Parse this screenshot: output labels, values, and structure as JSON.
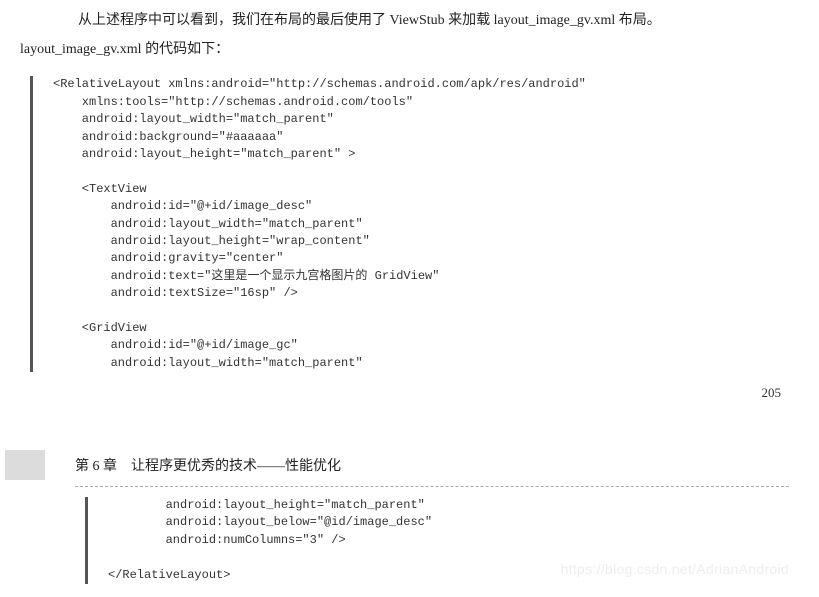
{
  "intro_para1": "从上述程序中可以看到，我们在布局的最后使用了 ViewStub 来加载 layout_image_gv.xml 布局。",
  "intro_para2": "layout_image_gv.xml 的代码如下：",
  "code_block1": "<RelativeLayout xmlns:android=\"http://schemas.android.com/apk/res/android\"\n    xmlns:tools=\"http://schemas.android.com/tools\"\n    android:layout_width=\"match_parent\"\n    android:background=\"#aaaaaa\"\n    android:layout_height=\"match_parent\" >\n\n    <TextView\n        android:id=\"@+id/image_desc\"\n        android:layout_width=\"match_parent\"\n        android:layout_height=\"wrap_content\"\n        android:gravity=\"center\"\n        android:text=\"这里是一个显示九宫格图片的 GridView\"\n        android:textSize=\"16sp\" />\n\n    <GridView\n        android:id=\"@+id/image_gc\"\n        android:layout_width=\"match_parent\"",
  "page_number": "205",
  "chapter_label": "第 6 章　让程序更优秀的技术——性能优化",
  "code_block2": "        android:layout_height=\"match_parent\"\n        android:layout_below=\"@id/image_desc\"\n        android:numColumns=\"3\" />\n\n</RelativeLayout>",
  "watermark": "https://blog.csdn.net/AdrianAndroid"
}
